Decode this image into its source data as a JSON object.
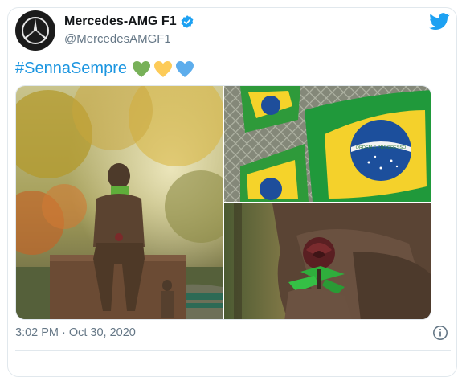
{
  "tweet": {
    "display_name": "Mercedes-AMG F1",
    "handle": "@MercedesAMGF1",
    "hashtag": "#SennaSempre",
    "hearts": [
      "green-heart-icon",
      "yellow-heart-icon",
      "blue-heart-icon"
    ],
    "time": "3:02 PM",
    "separator": "·",
    "date": "Oct 30, 2020"
  },
  "colors": {
    "link_blue": "#1b95e0",
    "twitter_blue": "#1da1f2",
    "verified_blue": "#1da1f2",
    "meta_gray": "#657786",
    "heart_green": "#78b159",
    "heart_yellow": "#fdcb58",
    "heart_blue": "#5dadec"
  },
  "flag": {
    "motto": "ORDEM E PROGRESSO"
  }
}
